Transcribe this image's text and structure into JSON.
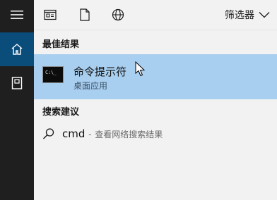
{
  "toolbar": {
    "filter_label": "筛选器"
  },
  "sections": {
    "best_match_title": "最佳结果",
    "suggestions_title": "搜索建议"
  },
  "best_match": {
    "name": "命令提示符",
    "subtitle": "桌面应用",
    "icon_text": "C:\\_"
  },
  "suggestion": {
    "query": "cmd",
    "separator": "-",
    "hint": "查看网络搜索结果"
  },
  "colors": {
    "rail": "#1f1f1f",
    "rail_active": "#0a4c7a",
    "highlight": "#a9cff0",
    "background": "#f2f2f2"
  }
}
